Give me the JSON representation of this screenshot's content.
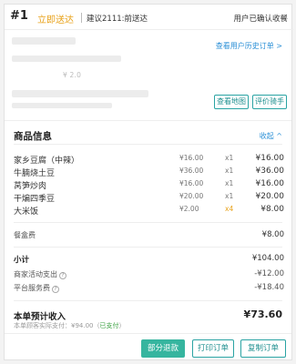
{
  "header": {
    "order_no": "#1",
    "status": "立即送达",
    "suggest_time": "建议2111:前送达",
    "cancel_note": "用户已确认收餐"
  },
  "customer": {
    "history_link": "查看用户历史订单 >",
    "price_hint": "¥ 2.0"
  },
  "actions": {
    "view_map": "查看地图",
    "rate_rider": "评价骑手"
  },
  "goods": {
    "title": "商品信息",
    "collapse": "收起 ^",
    "items": [
      {
        "name": "家乡豆腐（中辣）",
        "price": "¥16.00",
        "qty": "x1",
        "total": "¥16.00"
      },
      {
        "name": "牛腩烧土豆",
        "price": "¥36.00",
        "qty": "x1",
        "total": "¥36.00"
      },
      {
        "name": "莴笋炒肉",
        "price": "¥16.00",
        "qty": "x1",
        "total": "¥16.00"
      },
      {
        "name": "干煸四季豆",
        "price": "¥20.00",
        "qty": "x1",
        "total": "¥20.00"
      },
      {
        "name": "大米饭",
        "price": "¥2.00",
        "qty": "x4",
        "total": "¥8.00"
      }
    ],
    "box_fee_label": "餐盒费",
    "box_fee_value": "¥8.00"
  },
  "summary": {
    "subtotal_label": "小计",
    "subtotal_value": "¥104.00",
    "promo_label": "商家活动支出",
    "promo_value": "-¥12.00",
    "service_label": "平台服务费",
    "service_value": "-¥18.40",
    "income_label": "本单预计收入",
    "income_value": "¥73.60",
    "actual_paid": "本单顾客实际支付：¥94.00（",
    "paid_status": "已支付",
    "actual_paid_close": "）"
  },
  "footer": {
    "partial_refund": "部分退款",
    "print_order": "打印订单",
    "copy_order": "复制订单"
  },
  "colors": {
    "accent_orange": "#e8a21a",
    "link_blue": "#2a8fd6",
    "teal": "#36b59f"
  }
}
